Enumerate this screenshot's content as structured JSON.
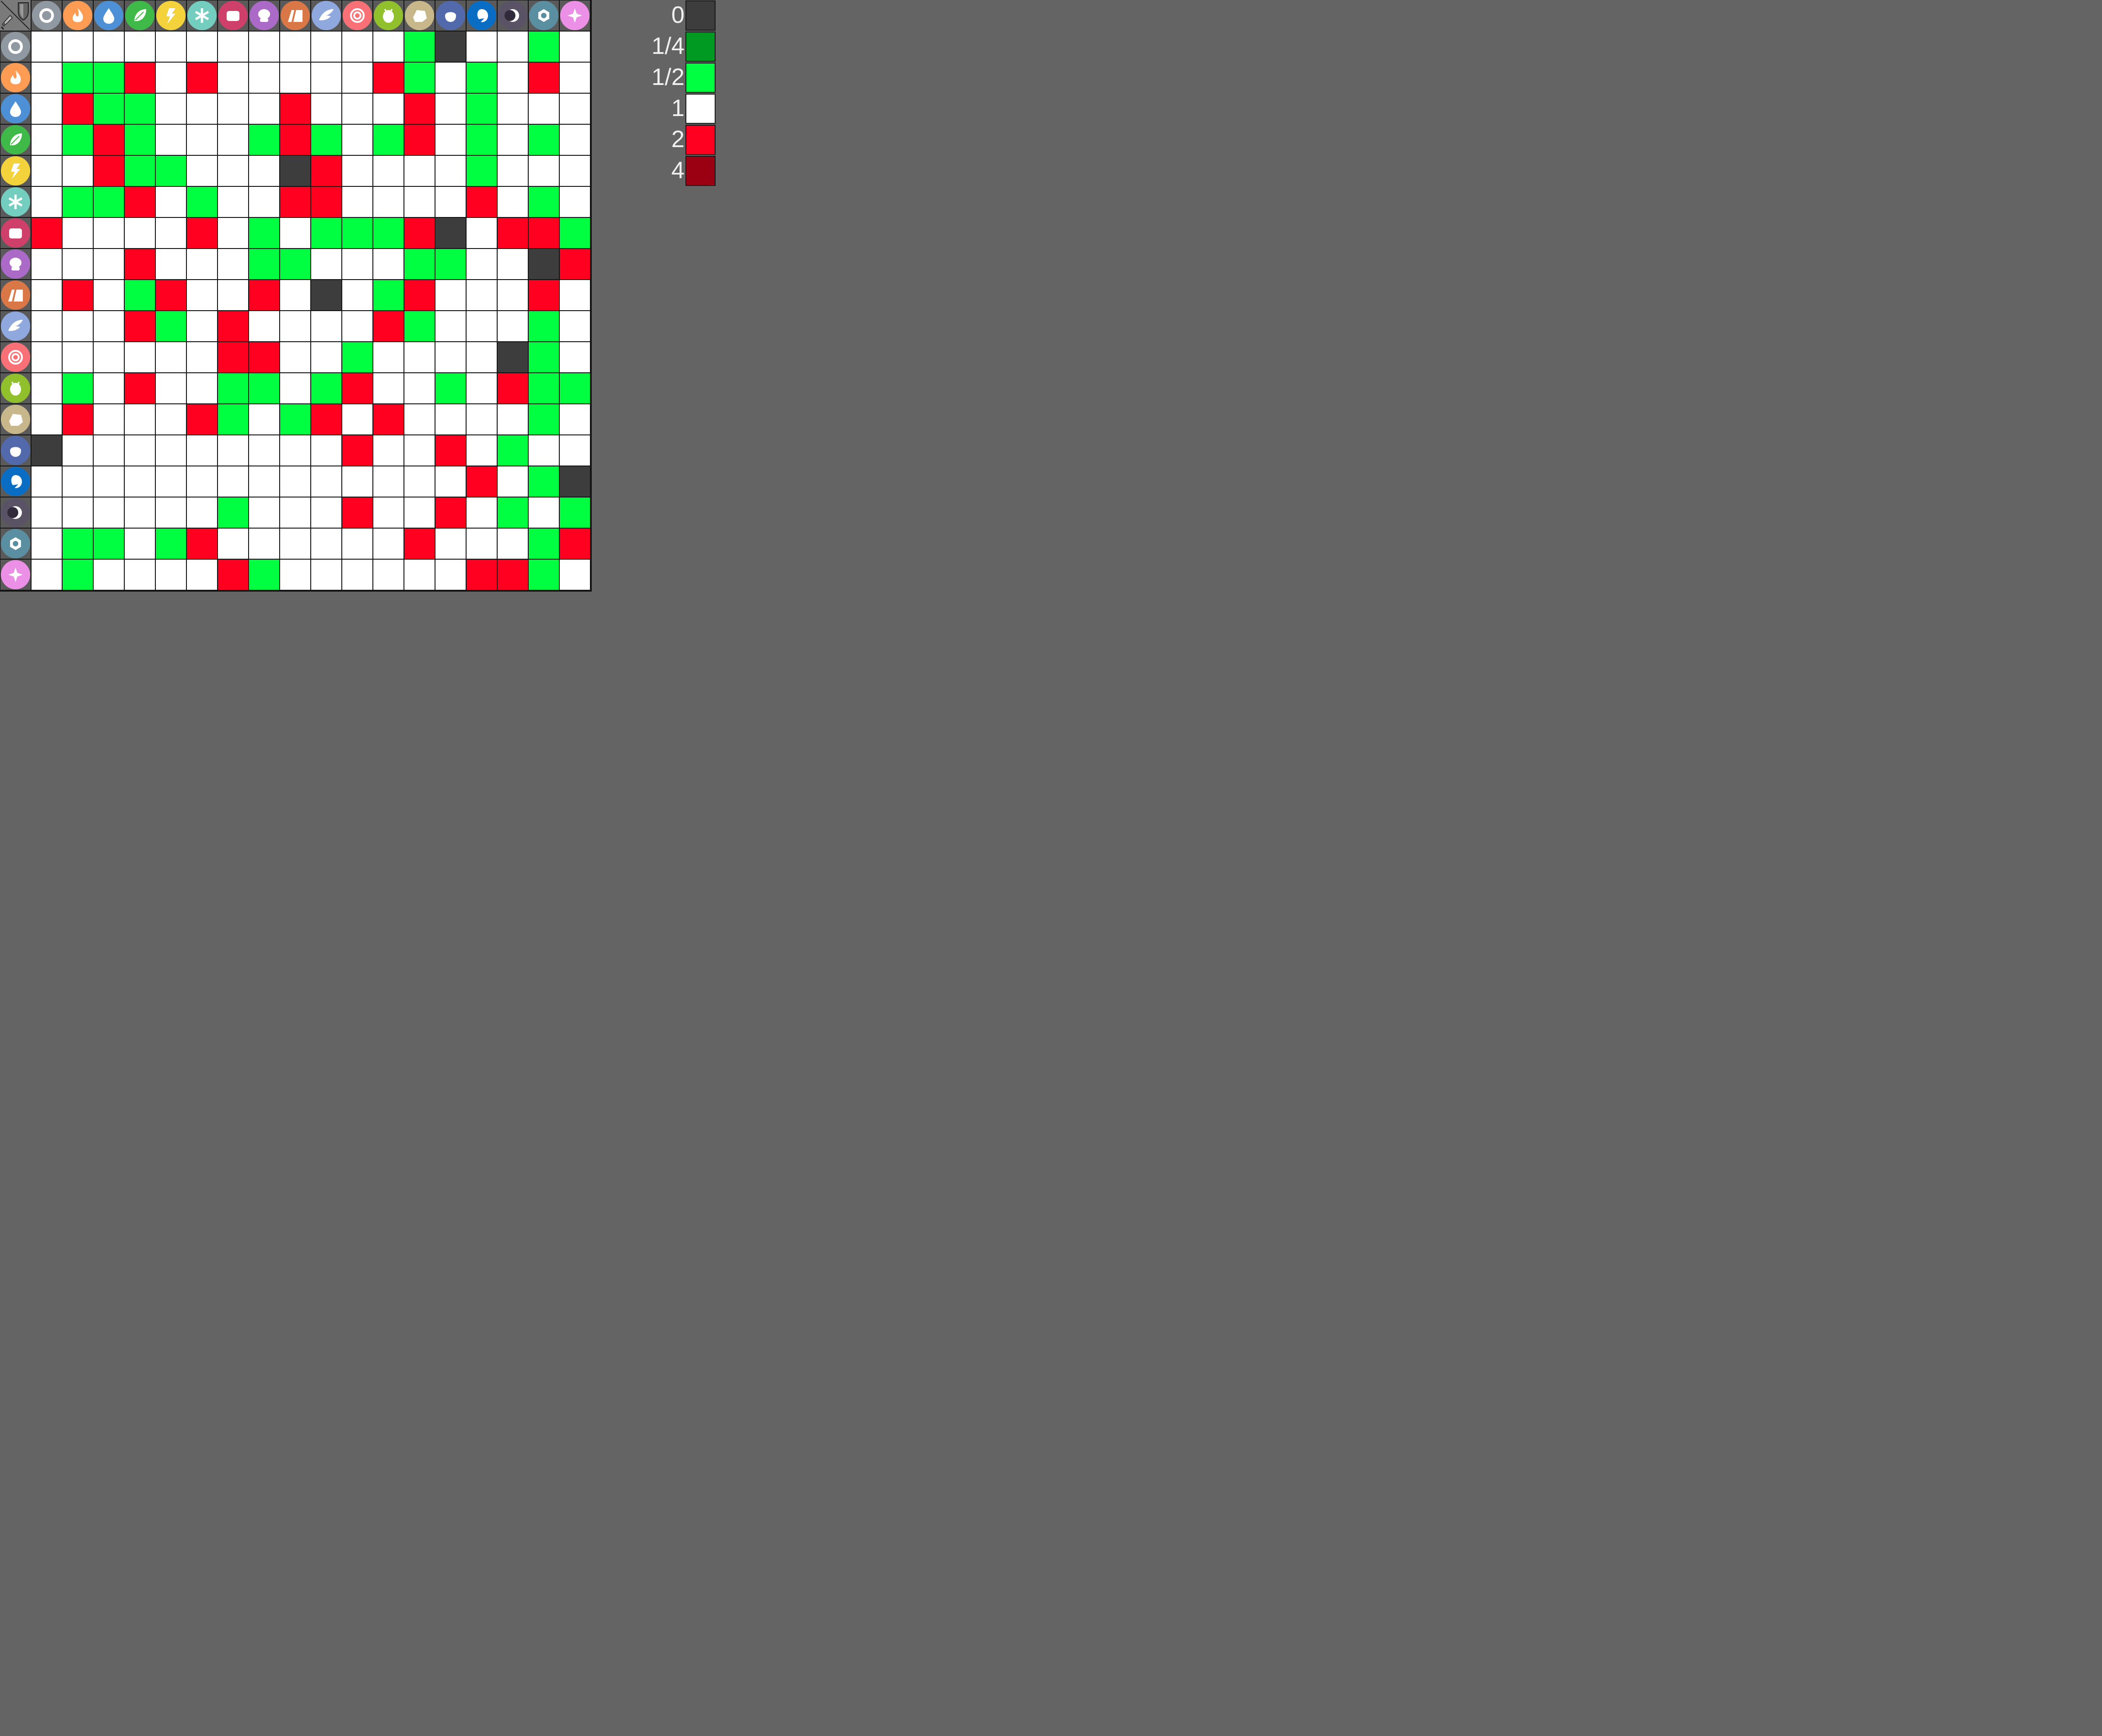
{
  "chart_data": {
    "type": "heatmap",
    "attacking_types": [
      "normal",
      "fire",
      "water",
      "grass",
      "electric",
      "ice",
      "fighting",
      "poison",
      "ground",
      "flying",
      "psychic",
      "bug",
      "rock",
      "ghost",
      "dragon",
      "dark",
      "steel",
      "fairy"
    ],
    "defending_types": [
      "normal",
      "fire",
      "water",
      "grass",
      "electric",
      "ice",
      "fighting",
      "poison",
      "ground",
      "flying",
      "psychic",
      "bug",
      "rock",
      "ghost",
      "dragon",
      "dark",
      "steel",
      "fairy"
    ],
    "matrix": [
      [
        1,
        1,
        1,
        1,
        1,
        1,
        1,
        1,
        1,
        1,
        1,
        1,
        0.5,
        0,
        1,
        1,
        0.5,
        1
      ],
      [
        1,
        0.5,
        0.5,
        2,
        1,
        2,
        1,
        1,
        1,
        1,
        1,
        2,
        0.5,
        1,
        0.5,
        1,
        2,
        1
      ],
      [
        1,
        2,
        0.5,
        0.5,
        1,
        1,
        1,
        1,
        2,
        1,
        1,
        1,
        2,
        1,
        0.5,
        1,
        1,
        1
      ],
      [
        1,
        0.5,
        2,
        0.5,
        1,
        1,
        1,
        0.5,
        2,
        0.5,
        1,
        0.5,
        2,
        1,
        0.5,
        1,
        0.5,
        1
      ],
      [
        1,
        1,
        2,
        0.5,
        0.5,
        1,
        1,
        1,
        0,
        2,
        1,
        1,
        1,
        1,
        0.5,
        1,
        1,
        1
      ],
      [
        1,
        0.5,
        0.5,
        2,
        1,
        0.5,
        1,
        1,
        2,
        2,
        1,
        1,
        1,
        1,
        2,
        1,
        0.5,
        1
      ],
      [
        2,
        1,
        1,
        1,
        1,
        2,
        1,
        0.5,
        1,
        0.5,
        0.5,
        0.5,
        2,
        0,
        1,
        2,
        2,
        0.5
      ],
      [
        1,
        1,
        1,
        2,
        1,
        1,
        1,
        0.5,
        0.5,
        1,
        1,
        1,
        0.5,
        0.5,
        1,
        1,
        0,
        2
      ],
      [
        1,
        2,
        1,
        0.5,
        2,
        1,
        1,
        2,
        1,
        0,
        1,
        0.5,
        2,
        1,
        1,
        1,
        2,
        1
      ],
      [
        1,
        1,
        1,
        2,
        0.5,
        1,
        2,
        1,
        1,
        1,
        1,
        2,
        0.5,
        1,
        1,
        1,
        0.5,
        1
      ],
      [
        1,
        1,
        1,
        1,
        1,
        1,
        2,
        2,
        1,
        1,
        0.5,
        1,
        1,
        1,
        1,
        0,
        0.5,
        1
      ],
      [
        1,
        0.5,
        1,
        2,
        1,
        1,
        0.5,
        0.5,
        1,
        0.5,
        2,
        1,
        1,
        0.5,
        1,
        2,
        0.5,
        0.5
      ],
      [
        1,
        2,
        1,
        1,
        1,
        2,
        0.5,
        1,
        0.5,
        2,
        1,
        2,
        1,
        1,
        1,
        1,
        0.5,
        1
      ],
      [
        0,
        1,
        1,
        1,
        1,
        1,
        1,
        1,
        1,
        1,
        2,
        1,
        1,
        2,
        1,
        0.5,
        1,
        1
      ],
      [
        1,
        1,
        1,
        1,
        1,
        1,
        1,
        1,
        1,
        1,
        1,
        1,
        1,
        1,
        2,
        1,
        0.5,
        0
      ],
      [
        1,
        1,
        1,
        1,
        1,
        1,
        0.5,
        1,
        1,
        1,
        2,
        1,
        1,
        2,
        1,
        0.5,
        1,
        0.5
      ],
      [
        1,
        0.5,
        0.5,
        1,
        0.5,
        2,
        1,
        1,
        1,
        1,
        1,
        1,
        2,
        1,
        1,
        1,
        0.5,
        2
      ],
      [
        1,
        0.5,
        1,
        1,
        1,
        1,
        2,
        0.5,
        1,
        1,
        1,
        1,
        1,
        1,
        2,
        2,
        0.5,
        1
      ]
    ],
    "legend": [
      {
        "label": "0",
        "value": 0,
        "color": "#3d3d3d"
      },
      {
        "label": "1/4",
        "value": 0.25,
        "color": "#009a22"
      },
      {
        "label": "1/2",
        "value": 0.5,
        "color": "#00ff40"
      },
      {
        "label": "1",
        "value": 1,
        "color": "#ffffff"
      },
      {
        "label": "2",
        "value": 2,
        "color": "#ff0020"
      },
      {
        "label": "4",
        "value": 4,
        "color": "#9a0012"
      }
    ],
    "type_colors": {
      "normal": "#9099a1",
      "fire": "#ff9c54",
      "water": "#4d90d5",
      "grass": "#3fba49",
      "electric": "#f4d23b",
      "ice": "#73cec0",
      "fighting": "#ce4069",
      "poison": "#ab6ac8",
      "ground": "#d97746",
      "flying": "#8fa8dd",
      "psychic": "#f97176",
      "bug": "#90c12c",
      "rock": "#c7b78b",
      "ghost": "#5269ac",
      "dragon": "#0a6dc4",
      "dark": "#5a5366",
      "steel": "#5a8ea1",
      "fairy": "#ec8fe6"
    },
    "corner_icons": [
      "sword-icon",
      "shield-icon"
    ],
    "type_icons": {
      "normal": "normal-type-icon",
      "fire": "fire-type-icon",
      "water": "water-type-icon",
      "grass": "grass-type-icon",
      "electric": "electric-type-icon",
      "ice": "ice-type-icon",
      "fighting": "fighting-type-icon",
      "poison": "poison-type-icon",
      "ground": "ground-type-icon",
      "flying": "flying-type-icon",
      "psychic": "psychic-type-icon",
      "bug": "bug-type-icon",
      "rock": "rock-type-icon",
      "ghost": "ghost-type-icon",
      "dragon": "dragon-type-icon",
      "dark": "dark-type-icon",
      "steel": "steel-type-icon",
      "fairy": "fairy-type-icon"
    }
  }
}
